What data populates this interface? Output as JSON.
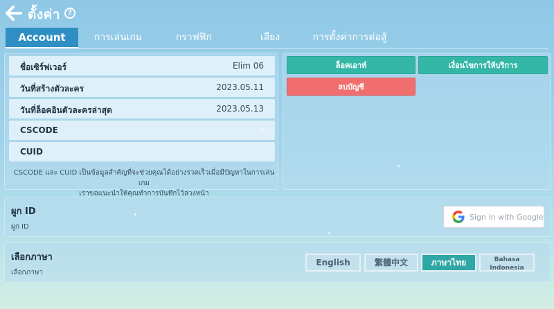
{
  "header": {
    "title": "ตั้งค่า",
    "help_glyph": "?"
  },
  "tabs": [
    {
      "label": "Account",
      "active": true
    },
    {
      "label": "การเล่นเกม",
      "active": false
    },
    {
      "label": "กราฟฟิก",
      "active": false
    },
    {
      "label": "เสียง",
      "active": false
    },
    {
      "label": "การตั้งค่าการต่อสู้",
      "active": false
    }
  ],
  "account": {
    "rows": [
      {
        "label": "ชื่อเซิร์ฟเวอร์",
        "value": "Elim 06"
      },
      {
        "label": "วันที่สร้างตัวละคร",
        "value": "2023.05.11"
      },
      {
        "label": "วันที่ล็อคอินตัวละครล่าสุด",
        "value": "2023.05.13"
      },
      {
        "label": "CSCODE",
        "value": ""
      },
      {
        "label": "CUID",
        "value": ""
      }
    ],
    "note_line1": "CSCODE และ CUID เป็นข้อมูลสำคัญที่จะช่วยคุณได้อย่างรวดเร็วเมื่อมีปัญหาในการเล่นเกม",
    "note_line2": "เราขอแนะนำให้คุณทำการบันทึกไว้ล่วงหน้า"
  },
  "actions": {
    "logout_label": "ล็อคเอาท์",
    "terms_label": "เงื่อนไขการให้บริการ",
    "delete_label": "ลบบัญชี"
  },
  "bind_id": {
    "title": "ผูก ID",
    "subtitle": "ผูก ID",
    "google_label": "Sign in with Google"
  },
  "language": {
    "title": "เลือกภาษา",
    "subtitle": "เลือกภาษา",
    "options": [
      {
        "label": "English",
        "active": false
      },
      {
        "label": "繁體中文",
        "active": false
      },
      {
        "label": "ภาษาไทย",
        "active": true
      },
      {
        "label_line1": "Bahasa",
        "label_line2": "Indonesia",
        "active": false
      }
    ]
  },
  "colors": {
    "accent_teal": "#35b7a8",
    "danger_red": "#f06e6e",
    "active_tab": "#2f8fc3",
    "active_lang": "#2fa7a5"
  },
  "icons": {
    "back": "back-arrow-icon",
    "help": "help-icon",
    "google": "google-icon"
  }
}
